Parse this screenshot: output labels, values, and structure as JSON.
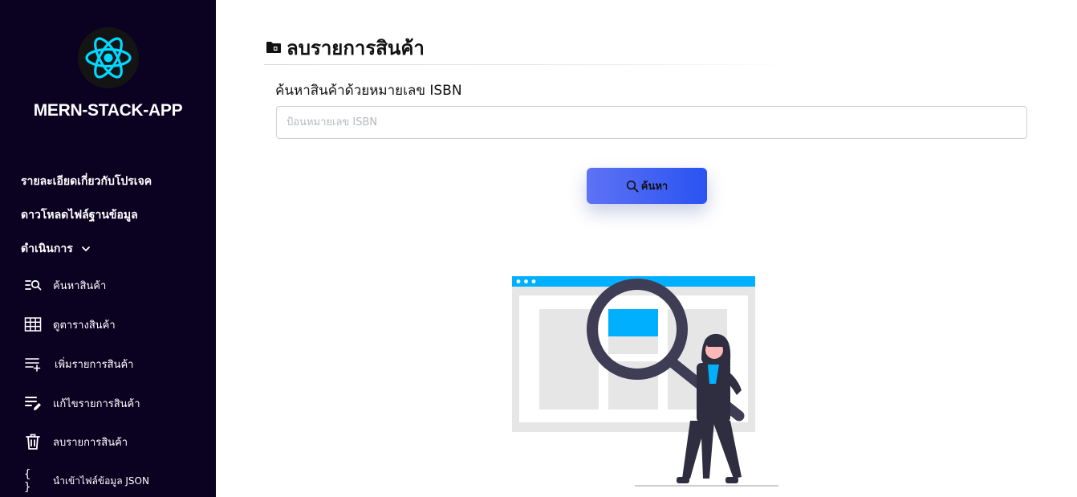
{
  "sidebar": {
    "app_name": "MERN-STACK-APP",
    "top_links": [
      {
        "label": "รายละเอียดเกี่ยวกับโปรเจค"
      },
      {
        "label": "ดาวโหลดไฟล์ฐานข้อมูล"
      },
      {
        "label": "ดำเนินการ",
        "expanded": true
      }
    ],
    "sub_items": [
      {
        "label": "ค้นหาสินค้า",
        "icon": "list-search-icon"
      },
      {
        "label": "ดูตารางสินค้า",
        "icon": "table-icon"
      },
      {
        "label": "เพิ่มรายการสินค้า",
        "icon": "playlist-add-icon"
      },
      {
        "label": "แก้ไขรายการสินค้า",
        "icon": "playlist-edit-icon"
      },
      {
        "label": "ลบรายการสินค้า",
        "icon": "trash-icon"
      },
      {
        "label": "นำเข้าไฟล์ข้อมูล JSON",
        "icon": "braces-icon"
      }
    ]
  },
  "main": {
    "title": "ลบรายการสินค้า",
    "search_label": "ค้นหาสินค้าด้วยหมายเลข ISBN",
    "search_placeholder": "ป้อนหมายเลข ISBN",
    "search_value": "",
    "search_button": "ค้นหา"
  },
  "colors": {
    "sidebar_bg": "#0b0222",
    "logo_accent": "#00d8ff",
    "button_start": "#5e72f4",
    "button_end": "#2a53f2",
    "illustration_accent": "#00b0ff"
  }
}
